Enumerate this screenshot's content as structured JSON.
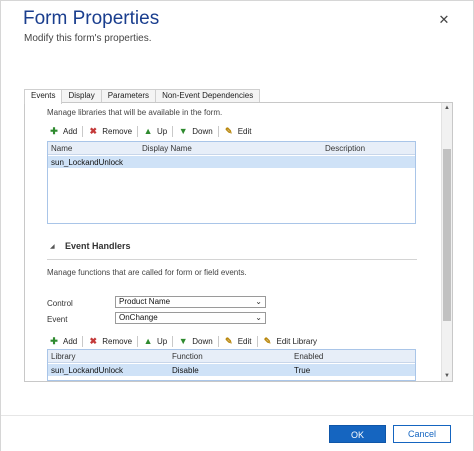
{
  "header": {
    "title": "Form Properties",
    "subtitle": "Modify this form's properties.",
    "close_glyph": "✕"
  },
  "tabs": [
    {
      "label": "Events",
      "active": true
    },
    {
      "label": "Display",
      "active": false
    },
    {
      "label": "Parameters",
      "active": false
    },
    {
      "label": "Non-Event Dependencies",
      "active": false
    }
  ],
  "libraries": {
    "description": "Manage libraries that will be available in the form.",
    "toolbar": {
      "add": "Add",
      "remove": "Remove",
      "up": "Up",
      "down": "Down",
      "edit": "Edit"
    },
    "columns": [
      "Name",
      "Display Name",
      "Description"
    ],
    "rows": [
      {
        "name": "sun_LockandUnlock",
        "display_name": "",
        "description": ""
      }
    ]
  },
  "event_handlers": {
    "title": "Event Handlers",
    "description": "Manage functions that are called for form or field events.",
    "control_label": "Control",
    "control_value": "Product Name",
    "event_label": "Event",
    "event_value": "OnChange",
    "toolbar": {
      "add": "Add",
      "remove": "Remove",
      "up": "Up",
      "down": "Down",
      "edit": "Edit",
      "edit_library": "Edit Library"
    },
    "columns": [
      "Library",
      "Function",
      "Enabled"
    ],
    "rows": [
      {
        "library": "sun_LockandUnlock",
        "function": "Disable",
        "enabled": "True"
      }
    ]
  },
  "footer": {
    "ok_label": "OK",
    "cancel_label": "Cancel"
  },
  "colors": {
    "title": "#1a3e8e",
    "primary_button": "#1565c0",
    "selected_row": "#cfe2f7"
  },
  "icons": {
    "add": "plus-icon",
    "remove": "remove-icon",
    "up": "arrow-up-icon",
    "down": "arrow-down-icon",
    "edit": "edit-icon",
    "close": "close-icon"
  }
}
